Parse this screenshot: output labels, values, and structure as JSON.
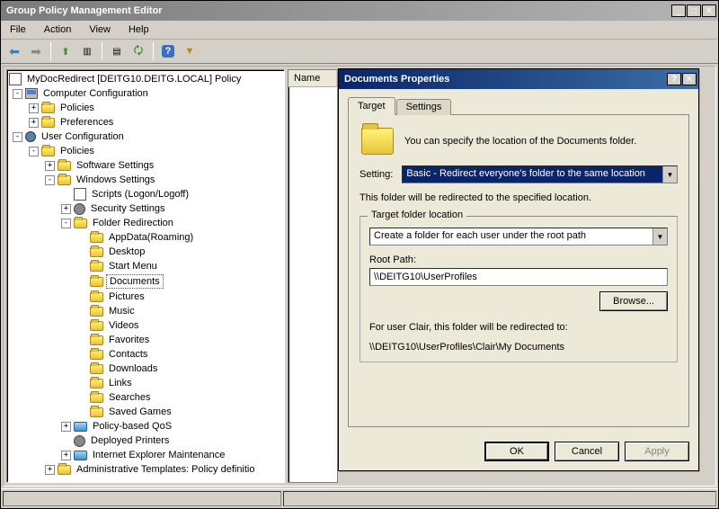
{
  "window": {
    "title": "Group Policy Management Editor"
  },
  "menu": {
    "file": "File",
    "action": "Action",
    "view": "View",
    "help": "Help"
  },
  "list": {
    "name_header": "Name"
  },
  "tree": {
    "root": "MyDocRedirect [DEITG10.DEITG.LOCAL] Policy",
    "computer_config": "Computer Configuration",
    "policies": "Policies",
    "preferences": "Preferences",
    "user_config": "User Configuration",
    "software_settings": "Software Settings",
    "windows_settings": "Windows Settings",
    "scripts": "Scripts (Logon/Logoff)",
    "security_settings": "Security Settings",
    "folder_redirection": "Folder Redirection",
    "fr": {
      "appdata": "AppData(Roaming)",
      "desktop": "Desktop",
      "start_menu": "Start Menu",
      "documents": "Documents",
      "pictures": "Pictures",
      "music": "Music",
      "videos": "Videos",
      "favorites": "Favorites",
      "contacts": "Contacts",
      "downloads": "Downloads",
      "links": "Links",
      "searches": "Searches",
      "saved_games": "Saved Games"
    },
    "qos": "Policy-based QoS",
    "printers": "Deployed Printers",
    "ie_maint": "Internet Explorer Maintenance",
    "admin_templates": "Administrative Templates: Policy definitio"
  },
  "dialog": {
    "title": "Documents Properties",
    "tabs": {
      "target": "Target",
      "settings": "Settings"
    },
    "desc": "You can specify the location of the Documents folder.",
    "setting_label": "Setting:",
    "setting_value": "Basic - Redirect everyone's folder to the same location",
    "redirect_note": "This folder will be redirected to the specified location.",
    "group_title": "Target folder location",
    "target_mode": "Create a folder for each user under the root path",
    "root_path_label": "Root Path:",
    "root_path_value": "\\\\DEITG10\\UserProfiles",
    "browse": "Browse...",
    "example_label": "For user Clair, this folder will be redirected to:",
    "example_path": "\\\\DEITG10\\UserProfiles\\Clair\\My Documents",
    "ok": "OK",
    "cancel": "Cancel",
    "apply": "Apply"
  }
}
